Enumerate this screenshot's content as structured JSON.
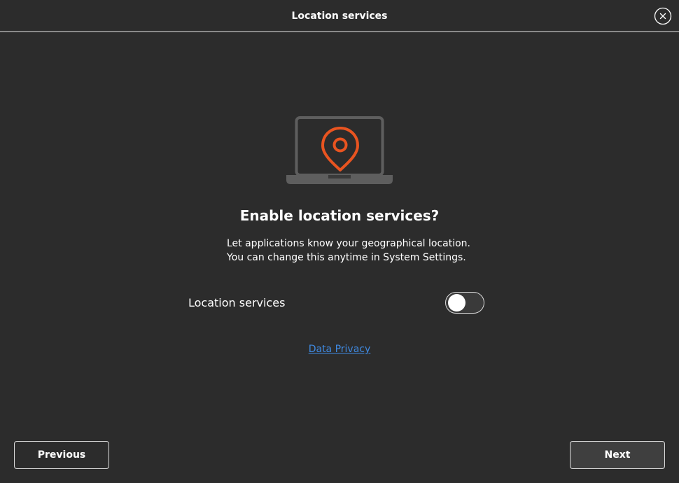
{
  "window": {
    "title": "Location services"
  },
  "page": {
    "heading": "Enable location services?",
    "description_line1": "Let applications know your geographical location.",
    "description_line2": "You can change this anytime in System Settings."
  },
  "setting": {
    "label": "Location services",
    "enabled": false
  },
  "links": {
    "privacy": "Data Privacy"
  },
  "buttons": {
    "previous": "Previous",
    "next": "Next"
  },
  "colors": {
    "background": "#2c2c2c",
    "accent_orange": "#e95420",
    "device_gray": "#5e5e5e",
    "link_blue": "#3f8ae2"
  },
  "icons": {
    "close": "close-icon",
    "illustration": "laptop-location-pin-illustration"
  }
}
